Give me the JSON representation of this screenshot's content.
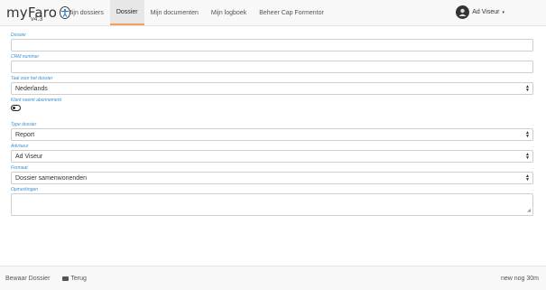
{
  "brand": {
    "name": "myFaro",
    "version": "v4.3",
    "logo_icon": "accessibility-icon"
  },
  "nav": {
    "items": [
      {
        "label": "Mijn dossiers",
        "active": false
      },
      {
        "label": "Dossier",
        "active": true
      },
      {
        "label": "Mijn documenten",
        "active": false
      },
      {
        "label": "Mijn logboek",
        "active": false
      },
      {
        "label": "Beheer Cap Formentor",
        "active": false
      }
    ],
    "user": {
      "name": "Ad Viseur",
      "avatar_icon": "user-avatar-icon",
      "caret": "▾"
    },
    "accent_color": "#f0a05a"
  },
  "form": {
    "dossier": {
      "label": "Dossier",
      "value": ""
    },
    "crm": {
      "label": "CRM nummer",
      "value": ""
    },
    "taal": {
      "label": "Taal voor het dossier",
      "value": "Nederlands"
    },
    "abonnement": {
      "label": "Klant neemt abonnement",
      "checked": false
    },
    "type": {
      "label": "Type dossier",
      "value": "Report"
    },
    "adviseur": {
      "label": "Adviseur",
      "value": "Ad Viseur"
    },
    "formaat": {
      "label": "Formaat",
      "value": "Dossier samenwonenden"
    },
    "opmerkingen": {
      "label": "Opmerkingen",
      "value": ""
    },
    "label_color": "#3a8fd0"
  },
  "footer": {
    "save_label": "Bewaar Dossier",
    "back_label": "Terug",
    "time_label": "new nog 30m"
  }
}
